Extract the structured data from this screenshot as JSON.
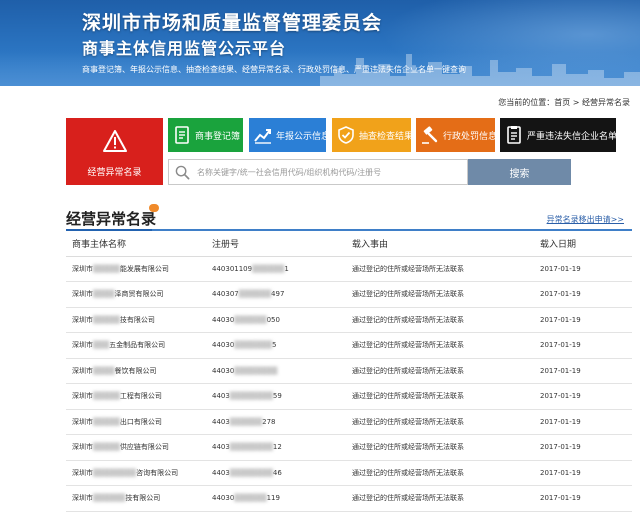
{
  "header": {
    "title": "深圳市市场和质量监督管理委员会",
    "subtitle": "商事主体信用监管公示平台",
    "links": "商事登记簿、年报公示信息、抽查检查结果、经营异常名录、行政处罚信息、严重违法失信企业名单一键查询"
  },
  "breadcrumb": {
    "prefix": "您当前的位置：",
    "home": "首页",
    "separator": ">",
    "current": "经营异常名录"
  },
  "featured_tile": {
    "label": "经营异常名录",
    "icon": "warning-icon",
    "color": "#d8201c"
  },
  "tiles": [
    {
      "label": "商事登记簿",
      "icon": "register-book-icon",
      "color": "#1aa33d"
    },
    {
      "label": "年报公示信息",
      "icon": "chart-trend-icon",
      "color": "#2b7fd6"
    },
    {
      "label": "抽查检查结果",
      "icon": "shield-check-icon",
      "color": "#f1a21a"
    },
    {
      "label": "行政处罚信息",
      "icon": "gavel-icon",
      "color": "#e46d17"
    },
    {
      "label": "严重违法失信企业名单",
      "icon": "blacklist-doc-icon",
      "color": "#141414"
    }
  ],
  "search": {
    "placeholder": "名称关键字/统一社会信用代码/组织机构代码/注册号",
    "button": "搜索"
  },
  "section": {
    "title": "经营异常名录",
    "more_link": "异常名录移出申请>>"
  },
  "table": {
    "columns": [
      "商事主体名称",
      "注册号",
      "载入事由",
      "载入日期"
    ],
    "rows": [
      {
        "name_pre": "深圳市",
        "name_hidden": "█████",
        "name_post": "能发展有限公司",
        "reg_pre": "440301109",
        "reg_hidden": "██████",
        "reg_post": "1",
        "reason": "通过登记的住所或经营场所无法联系",
        "date": "2017-01-19"
      },
      {
        "name_pre": "深圳市",
        "name_hidden": "████",
        "name_post": "泽商贸有限公司",
        "reg_pre": "440307",
        "reg_hidden": "██████",
        "reg_post": "497",
        "reason": "通过登记的住所或经营场所无法联系",
        "date": "2017-01-19"
      },
      {
        "name_pre": "深圳市",
        "name_hidden": "█████",
        "name_post": "技有限公司",
        "reg_pre": "44030",
        "reg_hidden": "██████",
        "reg_post": "050",
        "reason": "通过登记的住所或经营场所无法联系",
        "date": "2017-01-19"
      },
      {
        "name_pre": "深圳市",
        "name_hidden": "███",
        "name_post": "五金制品有限公司",
        "reg_pre": "44030",
        "reg_hidden": "███████",
        "reg_post": "5",
        "reason": "通过登记的住所或经营场所无法联系",
        "date": "2017-01-19"
      },
      {
        "name_pre": "深圳市",
        "name_hidden": "████",
        "name_post": "餐饮有限公司",
        "reg_pre": "44030",
        "reg_hidden": "████████",
        "reg_post": "",
        "reason": "通过登记的住所或经营场所无法联系",
        "date": "2017-01-19"
      },
      {
        "name_pre": "深圳市",
        "name_hidden": "█████",
        "name_post": "工程有限公司",
        "reg_pre": "4403",
        "reg_hidden": "████████",
        "reg_post": "59",
        "reason": "通过登记的住所或经营场所无法联系",
        "date": "2017-01-19"
      },
      {
        "name_pre": "深圳市",
        "name_hidden": "█████",
        "name_post": "出口有限公司",
        "reg_pre": "4403",
        "reg_hidden": "██████",
        "reg_post": "278",
        "reason": "通过登记的住所或经营场所无法联系",
        "date": "2017-01-19"
      },
      {
        "name_pre": "深圳市",
        "name_hidden": "█████",
        "name_post": "供应链有限公司",
        "reg_pre": "4403",
        "reg_hidden": "████████",
        "reg_post": "12",
        "reason": "通过登记的住所或经营场所无法联系",
        "date": "2017-01-19"
      },
      {
        "name_pre": "深圳市",
        "name_hidden": "████████",
        "name_post": "咨询有限公司",
        "reg_pre": "4403",
        "reg_hidden": "████████",
        "reg_post": "46",
        "reason": "通过登记的住所或经营场所无法联系",
        "date": "2017-01-19"
      },
      {
        "name_pre": "深圳市",
        "name_hidden": "██████",
        "name_post": "技有限公司",
        "reg_pre": "44030",
        "reg_hidden": "██████",
        "reg_post": "119",
        "reason": "通过登记的住所或经营场所无法联系",
        "date": "2017-01-19"
      }
    ]
  }
}
